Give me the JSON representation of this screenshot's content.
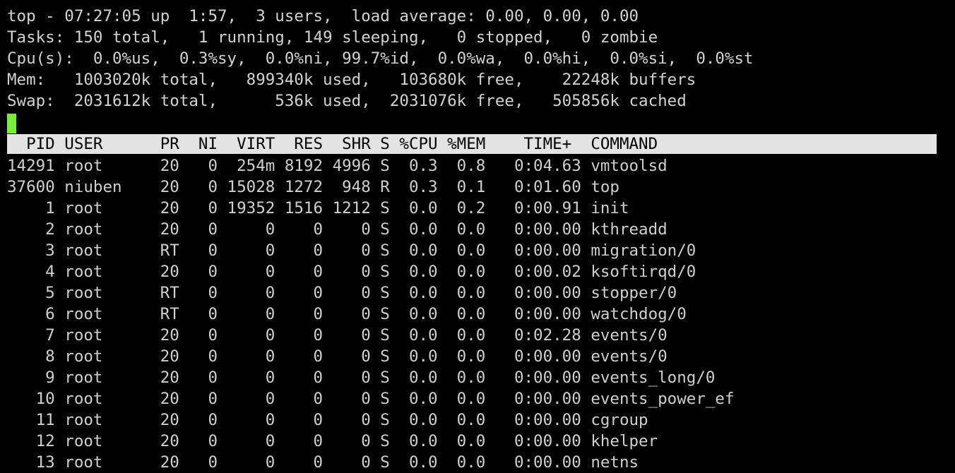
{
  "terminal": {
    "program": "top",
    "background_color": "#000000",
    "foreground_color": "#cfcfcf",
    "cursor_color": "#76ee3a",
    "header_bar_bg": "#e3e3e3",
    "header_bar_fg": "#000000"
  },
  "summary": {
    "uptime_line": "top - 07:27:05 up  1:57,  3 users,  load average: 0.00, 0.00, 0.00",
    "tasks_line": "Tasks: 150 total,   1 running, 149 sleeping,   0 stopped,   0 zombie",
    "cpu_line": "Cpu(s):  0.0%us,  0.3%sy,  0.0%ni, 99.7%id,  0.0%wa,  0.0%hi,  0.0%si,  0.0%st",
    "mem_line": "Mem:   1003020k total,   899340k used,   103680k free,    22248k buffers",
    "swap_line": "Swap:  2031612k total,      536k used,  2031076k free,   505856k cached",
    "fields": {
      "time": "07:27:05",
      "uptime": "1:57",
      "users": "3 users",
      "load_average": [
        "0.00",
        "0.00",
        "0.00"
      ],
      "tasks_total": "150",
      "tasks_running": "1",
      "tasks_sleeping": "149",
      "tasks_stopped": "0",
      "tasks_zombie": "0",
      "cpu_us": "0.0",
      "cpu_sy": "0.3",
      "cpu_ni": "0.0",
      "cpu_id": "99.7",
      "cpu_wa": "0.0",
      "cpu_hi": "0.0",
      "cpu_si": "0.0",
      "cpu_st": "0.0",
      "mem_total": "1003020k",
      "mem_used": "899340k",
      "mem_free": "103680k",
      "mem_buffers": "22248k",
      "swap_total": "2031612k",
      "swap_used": "536k",
      "swap_free": "2031076k",
      "swap_cached": "505856k"
    }
  },
  "blank_line": "",
  "table": {
    "header_line": "  PID USER      PR  NI  VIRT  RES  SHR S %CPU %MEM    TIME+  COMMAND                   ",
    "columns": [
      "PID",
      "USER",
      "PR",
      "NI",
      "VIRT",
      "RES",
      "SHR",
      "S",
      "%CPU",
      "%MEM",
      "TIME+",
      "COMMAND"
    ],
    "rows": [
      {
        "line": "14291 root      20   0  254m 8192 4996 S  0.3  0.8   0:04.63 vmtoolsd",
        "pid": "14291",
        "user": "root",
        "pr": "20",
        "ni": "0",
        "virt": "254m",
        "res": "8192",
        "shr": "4996",
        "s": "S",
        "cpu": "0.3",
        "mem": "0.8",
        "time": "0:04.63",
        "command": "vmtoolsd"
      },
      {
        "line": "37600 niuben    20   0 15028 1272  948 R  0.3  0.1   0:01.60 top",
        "pid": "37600",
        "user": "niuben",
        "pr": "20",
        "ni": "0",
        "virt": "15028",
        "res": "1272",
        "shr": "948",
        "s": "R",
        "cpu": "0.3",
        "mem": "0.1",
        "time": "0:01.60",
        "command": "top"
      },
      {
        "line": "    1 root      20   0 19352 1516 1212 S  0.0  0.2   0:00.91 init",
        "pid": "1",
        "user": "root",
        "pr": "20",
        "ni": "0",
        "virt": "19352",
        "res": "1516",
        "shr": "1212",
        "s": "S",
        "cpu": "0.0",
        "mem": "0.2",
        "time": "0:00.91",
        "command": "init"
      },
      {
        "line": "    2 root      20   0     0    0    0 S  0.0  0.0   0:00.00 kthreadd",
        "pid": "2",
        "user": "root",
        "pr": "20",
        "ni": "0",
        "virt": "0",
        "res": "0",
        "shr": "0",
        "s": "S",
        "cpu": "0.0",
        "mem": "0.0",
        "time": "0:00.00",
        "command": "kthreadd"
      },
      {
        "line": "    3 root      RT   0     0    0    0 S  0.0  0.0   0:00.00 migration/0",
        "pid": "3",
        "user": "root",
        "pr": "RT",
        "ni": "0",
        "virt": "0",
        "res": "0",
        "shr": "0",
        "s": "S",
        "cpu": "0.0",
        "mem": "0.0",
        "time": "0:00.00",
        "command": "migration/0"
      },
      {
        "line": "    4 root      20   0     0    0    0 S  0.0  0.0   0:00.02 ksoftirqd/0",
        "pid": "4",
        "user": "root",
        "pr": "20",
        "ni": "0",
        "virt": "0",
        "res": "0",
        "shr": "0",
        "s": "S",
        "cpu": "0.0",
        "mem": "0.0",
        "time": "0:00.02",
        "command": "ksoftirqd/0"
      },
      {
        "line": "    5 root      RT   0     0    0    0 S  0.0  0.0   0:00.00 stopper/0",
        "pid": "5",
        "user": "root",
        "pr": "RT",
        "ni": "0",
        "virt": "0",
        "res": "0",
        "shr": "0",
        "s": "S",
        "cpu": "0.0",
        "mem": "0.0",
        "time": "0:00.00",
        "command": "stopper/0"
      },
      {
        "line": "    6 root      RT   0     0    0    0 S  0.0  0.0   0:00.00 watchdog/0",
        "pid": "6",
        "user": "root",
        "pr": "RT",
        "ni": "0",
        "virt": "0",
        "res": "0",
        "shr": "0",
        "s": "S",
        "cpu": "0.0",
        "mem": "0.0",
        "time": "0:00.00",
        "command": "watchdog/0"
      },
      {
        "line": "    7 root      20   0     0    0    0 S  0.0  0.0   0:02.28 events/0",
        "pid": "7",
        "user": "root",
        "pr": "20",
        "ni": "0",
        "virt": "0",
        "res": "0",
        "shr": "0",
        "s": "S",
        "cpu": "0.0",
        "mem": "0.0",
        "time": "0:02.28",
        "command": "events/0"
      },
      {
        "line": "    8 root      20   0     0    0    0 S  0.0  0.0   0:00.00 events/0",
        "pid": "8",
        "user": "root",
        "pr": "20",
        "ni": "0",
        "virt": "0",
        "res": "0",
        "shr": "0",
        "s": "S",
        "cpu": "0.0",
        "mem": "0.0",
        "time": "0:00.00",
        "command": "events/0"
      },
      {
        "line": "    9 root      20   0     0    0    0 S  0.0  0.0   0:00.00 events_long/0",
        "pid": "9",
        "user": "root",
        "pr": "20",
        "ni": "0",
        "virt": "0",
        "res": "0",
        "shr": "0",
        "s": "S",
        "cpu": "0.0",
        "mem": "0.0",
        "time": "0:00.00",
        "command": "events_long/0"
      },
      {
        "line": "   10 root      20   0     0    0    0 S  0.0  0.0   0:00.00 events_power_ef",
        "pid": "10",
        "user": "root",
        "pr": "20",
        "ni": "0",
        "virt": "0",
        "res": "0",
        "shr": "0",
        "s": "S",
        "cpu": "0.0",
        "mem": "0.0",
        "time": "0:00.00",
        "command": "events_power_ef"
      },
      {
        "line": "   11 root      20   0     0    0    0 S  0.0  0.0   0:00.00 cgroup",
        "pid": "11",
        "user": "root",
        "pr": "20",
        "ni": "0",
        "virt": "0",
        "res": "0",
        "shr": "0",
        "s": "S",
        "cpu": "0.0",
        "mem": "0.0",
        "time": "0:00.00",
        "command": "cgroup"
      },
      {
        "line": "   12 root      20   0     0    0    0 S  0.0  0.0   0:00.00 khelper",
        "pid": "12",
        "user": "root",
        "pr": "20",
        "ni": "0",
        "virt": "0",
        "res": "0",
        "shr": "0",
        "s": "S",
        "cpu": "0.0",
        "mem": "0.0",
        "time": "0:00.00",
        "command": "khelper"
      },
      {
        "line": "   13 root      20   0     0    0    0 S  0.0  0.0   0:00.00 netns",
        "pid": "13",
        "user": "root",
        "pr": "20",
        "ni": "0",
        "virt": "0",
        "res": "0",
        "shr": "0",
        "s": "S",
        "cpu": "0.0",
        "mem": "0.0",
        "time": "0:00.00",
        "command": "netns"
      }
    ]
  }
}
